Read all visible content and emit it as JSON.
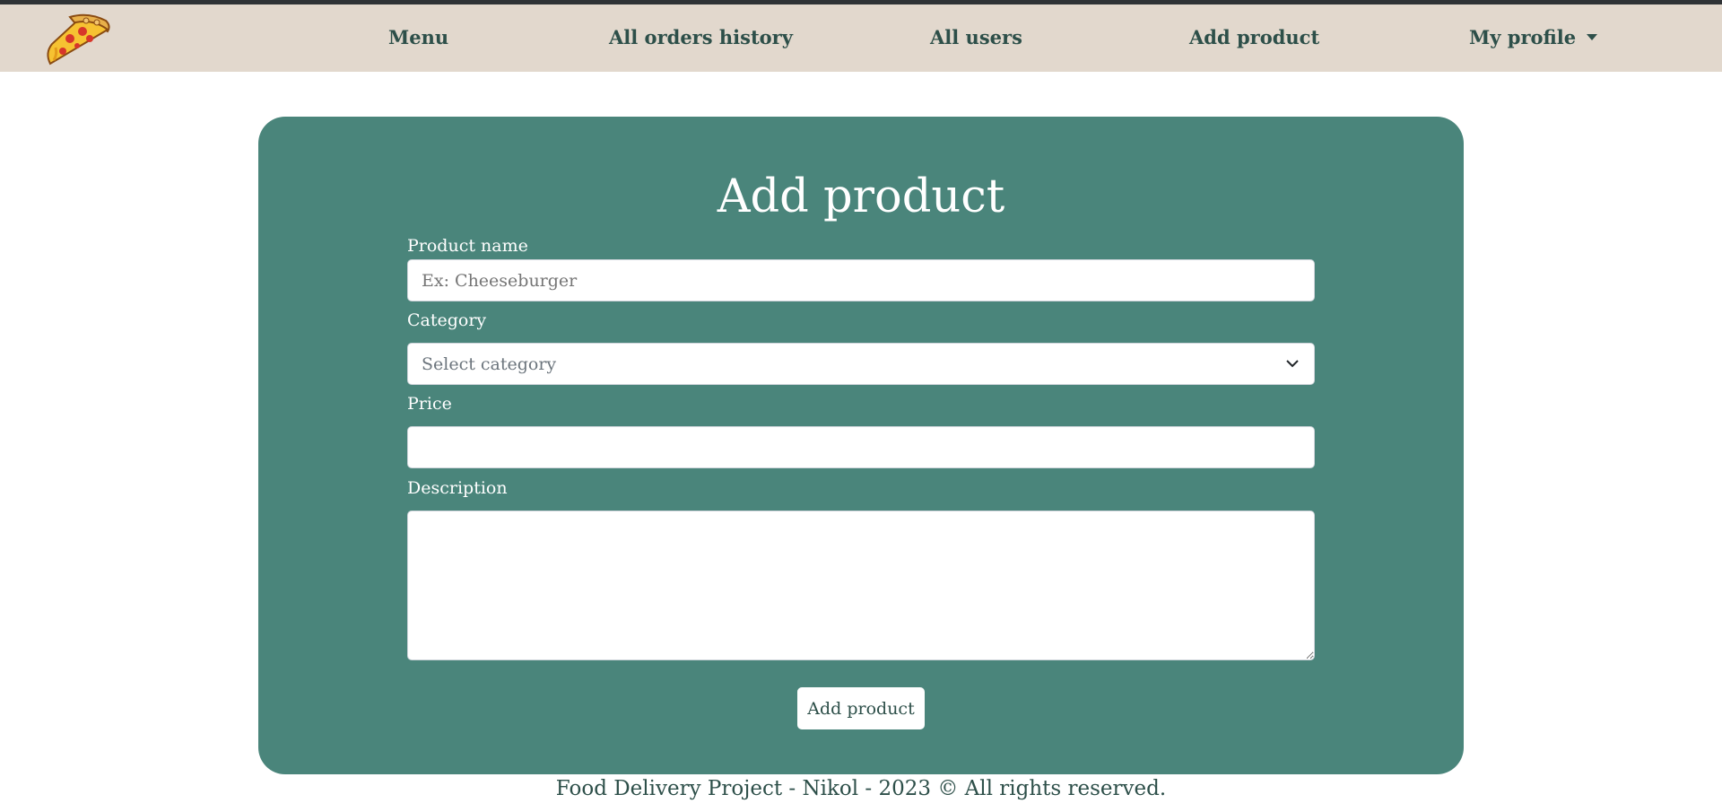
{
  "nav": {
    "logo_icon": "pizza-slice-icon",
    "items": [
      {
        "label": "Menu"
      },
      {
        "label": "All orders history"
      },
      {
        "label": "All users"
      },
      {
        "label": "Add product"
      },
      {
        "label": "My profile"
      }
    ]
  },
  "form": {
    "title": "Add product",
    "product_name": {
      "label": "Product name",
      "placeholder": "Ex: Cheeseburger",
      "value": ""
    },
    "category": {
      "label": "Category",
      "selected": "Select category"
    },
    "price": {
      "label": "Price",
      "value": ""
    },
    "description": {
      "label": "Description",
      "value": ""
    },
    "submit_label": "Add product"
  },
  "footer": {
    "text": "Food Delivery Project - Nikol - 2023 © All rights reserved."
  },
  "colors": {
    "navbar_bg": "#e2d8cd",
    "card_bg": "#4a857b",
    "text_dark": "#2d4f49",
    "white": "#ffffff"
  }
}
